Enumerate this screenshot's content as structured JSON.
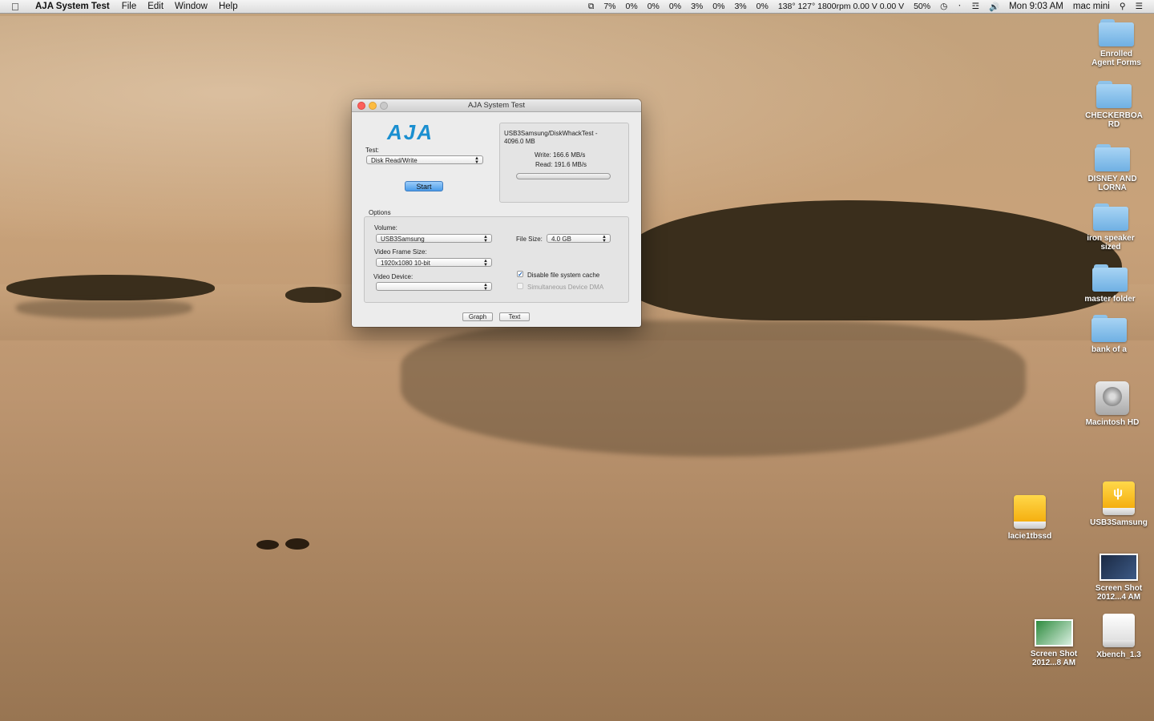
{
  "menubar": {
    "app_name": "AJA System Test",
    "menus": [
      "File",
      "Edit",
      "Window",
      "Help"
    ],
    "status": [
      "7%",
      "0%",
      "0%",
      "0%",
      "3%",
      "0%",
      "3%",
      "0%",
      "138° 127° 1800rpm 0.00 V 0.00 V",
      "50%"
    ],
    "clock": "Mon 9:03 AM",
    "user": "mac mini"
  },
  "window": {
    "title": "AJA System Test",
    "logo": "AJA",
    "test_label": "Test:",
    "test_value": "Disk Read/Write",
    "start_label": "Start",
    "result_path": "USB3Samsung/DiskWhackTest -",
    "result_size": "4096.0 MB",
    "write_result": "Write: 166.6 MB/s",
    "read_result": "Read: 191.6 MB/s",
    "options_label": "Options",
    "volume_label": "Volume:",
    "volume_value": "USB3Samsung",
    "file_size_label": "File Size:",
    "file_size_value": "4.0 GB",
    "frame_size_label": "Video Frame Size:",
    "frame_size_value": "1920x1080 10-bit",
    "video_device_label": "Video Device:",
    "video_device_value": "",
    "disable_cache_label": "Disable file system cache",
    "disable_cache_checked": true,
    "simultaneous_dma_label": "Simultaneous Device DMA",
    "simultaneous_dma_checked": false,
    "graph_label": "Graph",
    "text_label": "Text"
  },
  "desktop_icons": [
    {
      "label_1": "Enrolled",
      "label_2": "Agent Forms",
      "icon": "folder-icon"
    },
    {
      "label_1": "CHECKERBOA",
      "label_2": "RD",
      "icon": "folder-icon"
    },
    {
      "label_1": "DISNEY AND",
      "label_2": "LORNA",
      "icon": "folder-icon"
    },
    {
      "label_1": "iron speaker",
      "label_2": "sized",
      "icon": "folder-icon"
    },
    {
      "label_1": "master folder",
      "label_2": "",
      "icon": "folder-icon"
    },
    {
      "label_1": "bank of a",
      "label_2": "",
      "icon": "folder-icon"
    },
    {
      "label_1": "Macintosh HD",
      "label_2": "",
      "icon": "hard-drive-icon"
    },
    {
      "label_1": "USB3Samsung",
      "label_2": "",
      "icon": "usb-drive-icon"
    },
    {
      "label_1": "lacie1tbssd",
      "label_2": "",
      "icon": "external-drive-icon"
    },
    {
      "label_1": "Screen Shot",
      "label_2": "2012...4 AM",
      "icon": "screenshot-thumbnail-icon"
    },
    {
      "label_1": "Screen Shot",
      "label_2": "2012...8 AM",
      "icon": "screenshot-thumbnail-icon"
    },
    {
      "label_1": "Xbench_1.3",
      "label_2": "",
      "icon": "disk-image-icon"
    }
  ],
  "colors": {
    "accent": "#1a8fd0",
    "start_button": "#4a9ce9"
  }
}
